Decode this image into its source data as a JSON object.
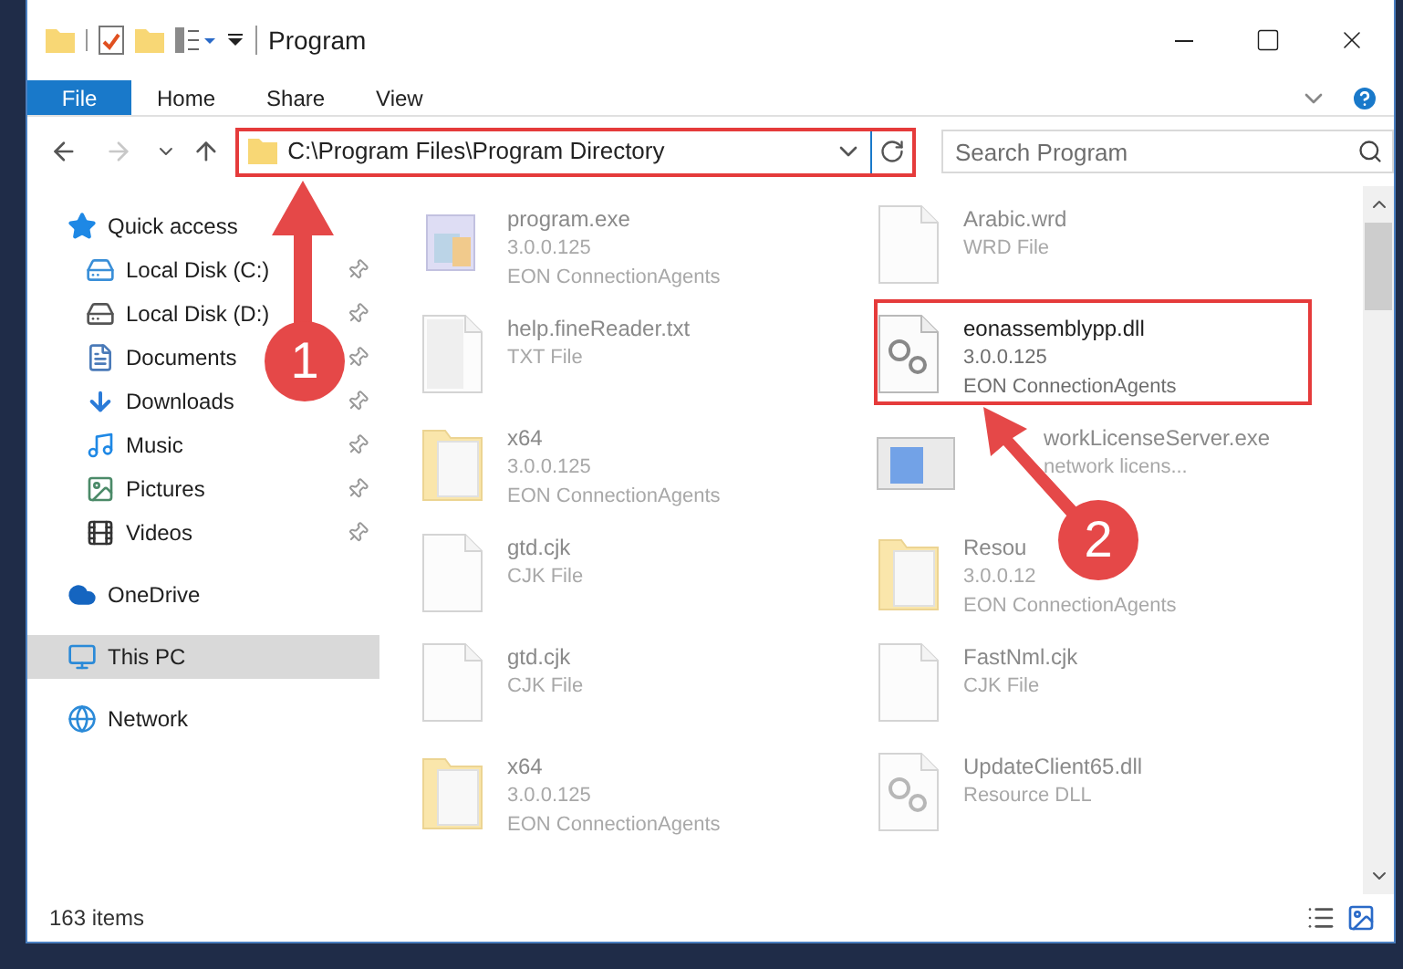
{
  "window": {
    "title": "Program"
  },
  "ribbon": {
    "tabs": [
      {
        "label": "File",
        "selected": true
      },
      {
        "label": "Home",
        "selected": false
      },
      {
        "label": "Share",
        "selected": false
      },
      {
        "label": "View",
        "selected": false
      }
    ]
  },
  "address_bar": {
    "path": "C:\\Program Files\\Program Directory"
  },
  "search": {
    "placeholder": "Search Program"
  },
  "sidebar": {
    "items": [
      {
        "label": "Quick access",
        "kind": "star",
        "selected": false,
        "children": [
          {
            "label": "Local Disk (C:)",
            "kind": "system-drive",
            "pinned": true
          },
          {
            "label": "Local Disk (D:)",
            "kind": "drive",
            "pinned": true
          },
          {
            "label": "Documents",
            "kind": "documents",
            "pinned": true
          },
          {
            "label": "Downloads",
            "kind": "downloads",
            "pinned": true
          },
          {
            "label": "Music",
            "kind": "music",
            "pinned": true
          },
          {
            "label": "Pictures",
            "kind": "pictures",
            "pinned": true
          },
          {
            "label": "Videos",
            "kind": "videos",
            "pinned": true
          }
        ]
      },
      {
        "label": "OneDrive",
        "kind": "cloud",
        "selected": false
      },
      {
        "label": "This PC",
        "kind": "pc",
        "selected": true
      },
      {
        "label": "Network",
        "kind": "network",
        "selected": false
      }
    ]
  },
  "files": [
    {
      "name": "program.exe",
      "lines": [
        "3.0.0.125",
        "EON ConnectionAgents"
      ],
      "kind": "exe",
      "blurred": true
    },
    {
      "name": "Arabic.wrd",
      "lines": [
        "WRD File"
      ],
      "kind": "blank",
      "blurred": true
    },
    {
      "name": "help.fineReader.txt",
      "lines": [
        "TXT File"
      ],
      "kind": "text",
      "blurred": true
    },
    {
      "name": "eonassemblypp.dll",
      "lines": [
        "3.0.0.125",
        "EON ConnectionAgents"
      ],
      "kind": "dll",
      "blurred": false
    },
    {
      "name": "x64",
      "lines": [
        "3.0.0.125",
        "EON ConnectionAgents"
      ],
      "kind": "folder",
      "blurred": true
    },
    {
      "name": "workLicenseServer.exe",
      "lines": [
        "network licens..."
      ],
      "kind": "app",
      "blurred": true
    },
    {
      "name": "gtd.cjk",
      "lines": [
        "CJK File"
      ],
      "kind": "blank",
      "blurred": true
    },
    {
      "name": "Resou",
      "lines": [
        "3.0.0.12",
        "EON ConnectionAgents"
      ],
      "kind": "folder",
      "blurred": true
    },
    {
      "name": "gtd.cjk",
      "lines": [
        "CJK File"
      ],
      "kind": "blank",
      "blurred": true
    },
    {
      "name": "FastNml.cjk",
      "lines": [
        "CJK File"
      ],
      "kind": "blank",
      "blurred": true
    },
    {
      "name": "x64",
      "lines": [
        "3.0.0.125",
        "EON ConnectionAgents"
      ],
      "kind": "folder",
      "blurred": true
    },
    {
      "name": "UpdateClient65.dll",
      "lines": [
        "Resource DLL"
      ],
      "kind": "dll",
      "blurred": true
    }
  ],
  "status_bar": {
    "count": "163 items"
  },
  "annotations": [
    {
      "label": "1"
    },
    {
      "label": "2"
    }
  ]
}
